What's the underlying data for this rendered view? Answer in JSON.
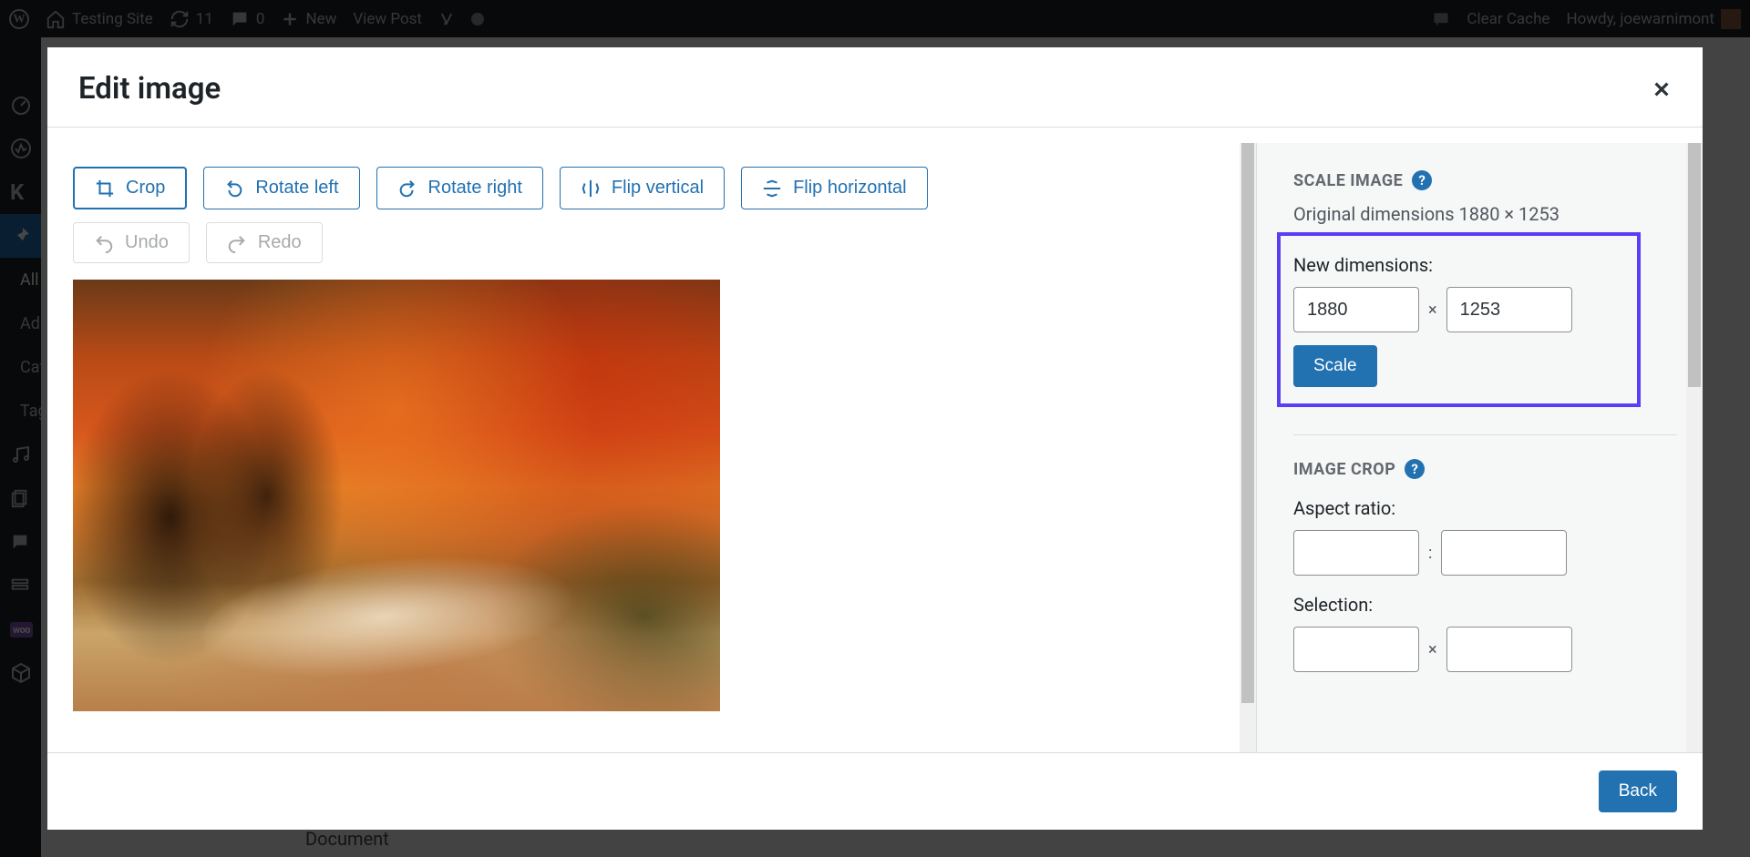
{
  "adminbar": {
    "site_name": "Testing Site",
    "updates": "11",
    "comments": "0",
    "new": "New",
    "view_post": "View Post",
    "clear_cache": "Clear Cache",
    "howdy": "Howdy, joewarnimont"
  },
  "adminmenu": {
    "items": [
      "All",
      "Ad",
      "Cat",
      "Tag"
    ],
    "products": "Products"
  },
  "bg": {
    "document_tab": "Document"
  },
  "modal": {
    "title": "Edit image",
    "toolbar": {
      "crop": "Crop",
      "rotate_left": "Rotate left",
      "rotate_right": "Rotate right",
      "flip_v": "Flip vertical",
      "flip_h": "Flip horizontal",
      "undo": "Undo",
      "redo": "Redo"
    },
    "footer": {
      "back": "Back"
    }
  },
  "sidebar": {
    "scale_title": "SCALE IMAGE",
    "orig_dim_label": "Original dimensions 1880 × 1253",
    "new_dim_label": "New dimensions:",
    "width": "1880",
    "height": "1253",
    "scale_btn": "Scale",
    "crop_title": "IMAGE CROP",
    "aspect_label": "Aspect ratio:",
    "aspect_sep": ":",
    "selection_label": "Selection:",
    "selection_sep": "×"
  }
}
